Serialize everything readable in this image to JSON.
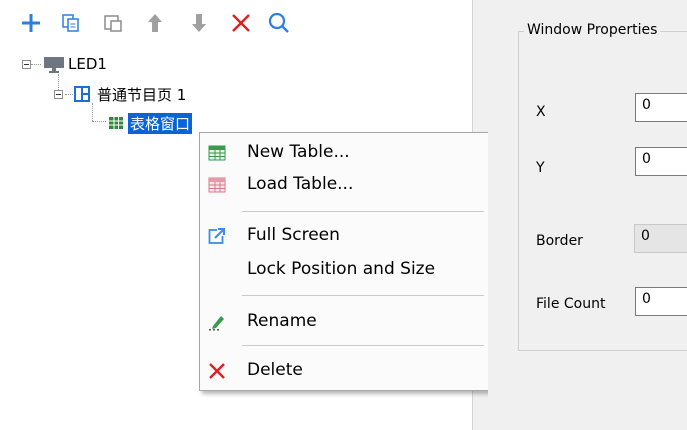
{
  "toolbar": {
    "buttons": [
      {
        "icon": "plus-icon",
        "color": "#2a7fe0"
      },
      {
        "icon": "copy-icon",
        "color": "#2a7fe0"
      },
      {
        "icon": "paste-icon",
        "color": "#8c8c8c"
      },
      {
        "icon": "arrow-up-icon",
        "color": "#a0a0a0"
      },
      {
        "icon": "arrow-down-icon",
        "color": "#a0a0a0"
      },
      {
        "icon": "delete-x-icon",
        "color": "#e02020"
      },
      {
        "icon": "search-icon",
        "color": "#2a7fe0"
      }
    ]
  },
  "tree": {
    "screen": {
      "label": "LED1",
      "icon": "monitor-icon"
    },
    "program": {
      "label": "普通节目页 1",
      "icon": "program-page-icon"
    },
    "window": {
      "label": "表格窗口",
      "icon": "table-window-icon",
      "selected": true
    }
  },
  "context_menu": {
    "items": [
      {
        "label": "New Table...",
        "icon": "new-table-icon"
      },
      {
        "label": "Load Table...",
        "icon": "load-table-icon"
      },
      {
        "label": "Full Screen",
        "icon": "full-screen-icon"
      },
      {
        "label": "Lock Position and Size",
        "icon": ""
      },
      {
        "label": "Rename",
        "icon": "rename-pen-icon"
      },
      {
        "label": "Delete",
        "icon": "delete-x-icon"
      }
    ]
  },
  "properties": {
    "group_title": "Window Properties",
    "x": {
      "label": "X",
      "value": "0"
    },
    "y": {
      "label": "Y",
      "value": "0"
    },
    "border": {
      "label": "Border",
      "value": "0"
    },
    "file_count": {
      "label": "File Count",
      "value": "0"
    }
  },
  "colors": {
    "selection": "#0a64d8",
    "accent": "#2a7fe0",
    "danger": "#e02020"
  }
}
